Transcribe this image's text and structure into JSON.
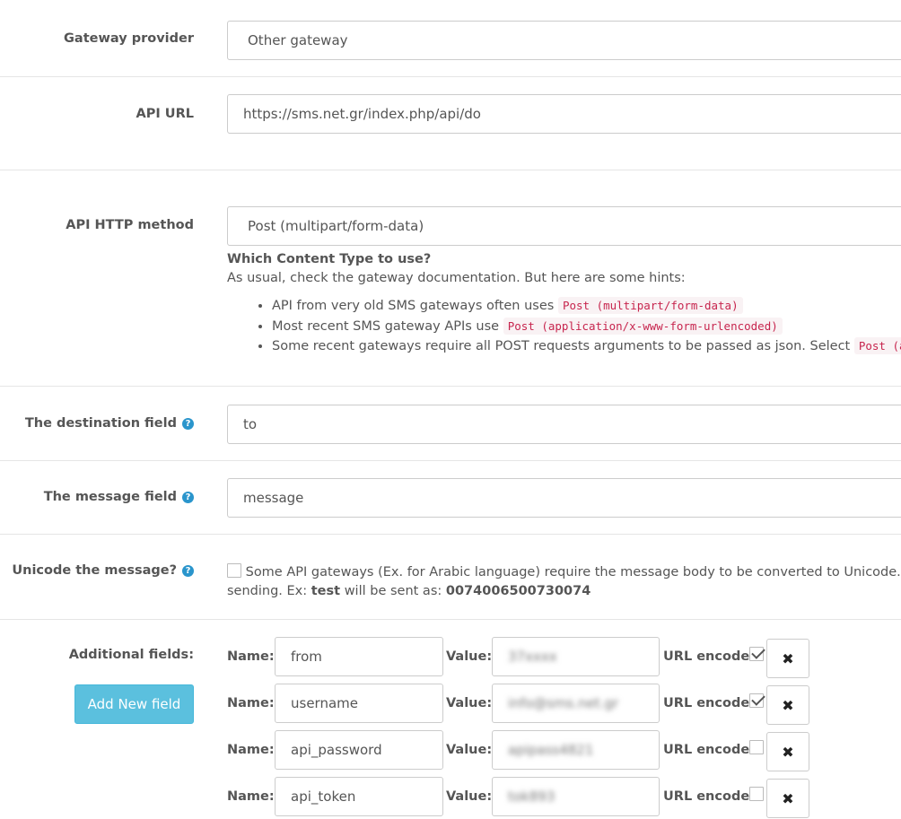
{
  "gateway_provider": {
    "label": "Gateway provider",
    "value": "Other gateway"
  },
  "api_url": {
    "label": "API URL",
    "value": "https://sms.net.gr/index.php/api/do"
  },
  "api_http_method": {
    "label": "API HTTP method",
    "value": "Post (multipart/form-data)",
    "hint_title": "Which Content Type to use?",
    "hint_text": "As usual, check the gateway documentation. But here are some hints:",
    "hints": [
      {
        "text": "API from very old SMS gateways often uses",
        "code": "Post (multipart/form-data)"
      },
      {
        "text": "Most recent SMS gateway APIs use",
        "code": "Post (application/x-www-form-urlencoded)"
      },
      {
        "text": "Some recent gateways require all POST requests arguments to be passed as json. Select",
        "code": "Post (appl"
      }
    ]
  },
  "destination_field": {
    "label": "The destination field",
    "value": "to"
  },
  "message_field": {
    "label": "The message field",
    "value": "message"
  },
  "unicode": {
    "label": "Unicode the message?",
    "checked": false,
    "text_1": "Some API gateways (Ex. for Arabic language) require the message body to be converted to Unicode. We re",
    "text_2": "sending. Ex:",
    "example_word": "test",
    "text_3": "will be sent as:",
    "example_result": "0074006500730074"
  },
  "additional_fields": {
    "label": "Additional fields:",
    "add_button_label": "Add New field",
    "name_label": "Name:",
    "value_label": "Value:",
    "url_encode_label": "URL encode:",
    "delete_icon": "✖",
    "rows": [
      {
        "name": "from",
        "value": "37xxxx",
        "url_encode": true
      },
      {
        "name": "username",
        "value": "info@sms.net.gr",
        "url_encode": true
      },
      {
        "name": "api_password",
        "value": "apipass4821",
        "url_encode": false
      },
      {
        "name": "api_token",
        "value": "tok893",
        "url_encode": false
      }
    ]
  }
}
